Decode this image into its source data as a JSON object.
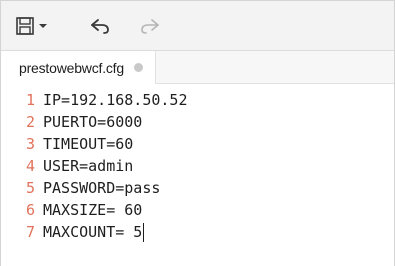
{
  "toolbar": {
    "icons": [
      "save-icon",
      "dropdown-arrow-icon",
      "undo-icon",
      "redo-icon"
    ]
  },
  "tab": {
    "title": "prestowebwcf.cfg",
    "modified_indicator": "unsaved-dot"
  },
  "editor": {
    "lines": [
      {
        "number": "1",
        "text": "IP=192.168.50.52"
      },
      {
        "number": "2",
        "text": "PUERTO=6000"
      },
      {
        "number": "3",
        "text": "TIMEOUT=60"
      },
      {
        "number": "4",
        "text": "USER=admin"
      },
      {
        "number": "5",
        "text": "PASSWORD=pass"
      },
      {
        "number": "6",
        "text": "MAXSIZE= 60"
      },
      {
        "number": "7",
        "text": "MAXCOUNT= 5"
      }
    ],
    "line_number_color": "#e2725b",
    "text_color": "#1e1e1e"
  }
}
